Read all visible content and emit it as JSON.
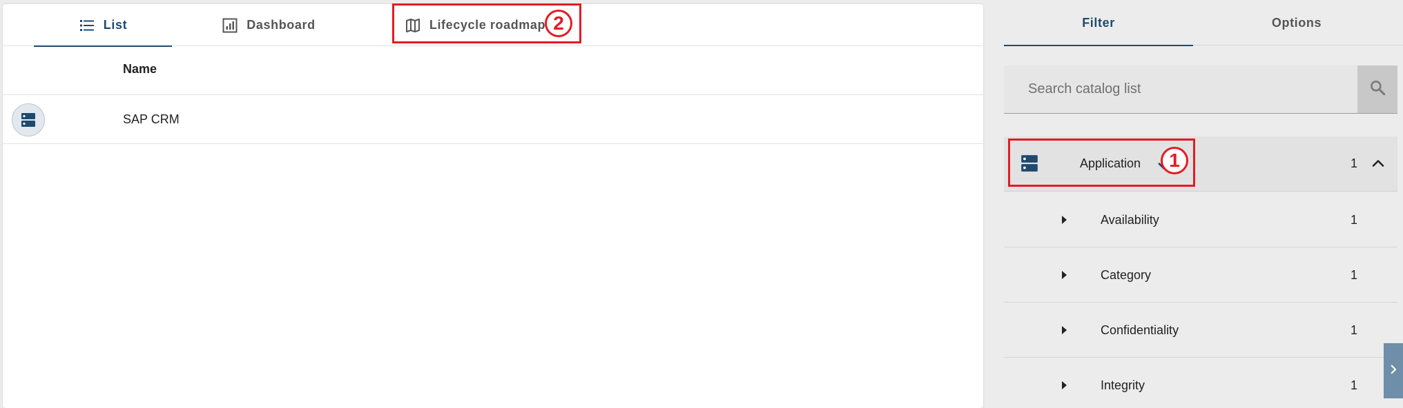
{
  "tabs": {
    "list": "List",
    "dashboard": "Dashboard",
    "roadmap": "Lifecycle roadmap"
  },
  "callouts": {
    "one": "1",
    "two": "2"
  },
  "table": {
    "column_name": "Name",
    "rows": [
      {
        "name": "SAP CRM",
        "icon": "application-icon"
      }
    ]
  },
  "sidebar": {
    "tabs": {
      "filter": "Filter",
      "options": "Options"
    },
    "search": {
      "placeholder": "Search catalog list"
    },
    "facet": {
      "label": "Application",
      "count": "1",
      "icon": "application-icon",
      "checked": true
    },
    "subfacets": [
      {
        "label": "Availability",
        "count": "1"
      },
      {
        "label": "Category",
        "count": "1"
      },
      {
        "label": "Confidentiality",
        "count": "1"
      },
      {
        "label": "Integrity",
        "count": "1"
      }
    ]
  },
  "colors": {
    "accent": "#1e4a6e",
    "callout": "#e31b23",
    "panel_bg": "#ececec"
  }
}
